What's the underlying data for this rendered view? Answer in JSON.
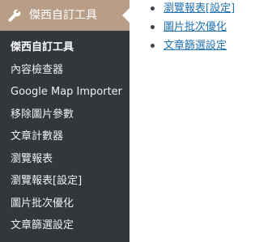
{
  "menu": {
    "active_label": "傑西自訂工具",
    "active_icon": "wrench-icon",
    "submenu_items": [
      "傑西自訂工具",
      "內容檢查器",
      "Google Map Importer",
      "移除圖片參數",
      "文章計數器",
      "瀏覽報表",
      "瀏覽報表[設定]",
      "圖片批次優化",
      "文章篩選設定"
    ]
  },
  "content": {
    "links": [
      "瀏覽報表[設定]",
      "圖片批次優化",
      "文章篩選設定"
    ]
  },
  "colors": {
    "sidebar_bg": "#32373c",
    "active_bg": "#b89e86",
    "link": "#2271b1"
  }
}
